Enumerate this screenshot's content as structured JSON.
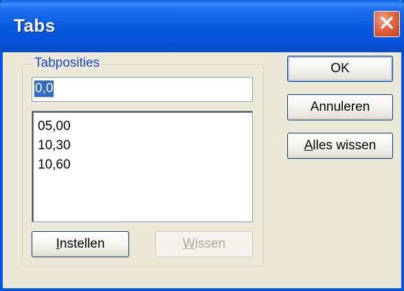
{
  "window": {
    "title": "Tabs"
  },
  "group": {
    "label": "Tabposities"
  },
  "input": {
    "value": "0,0"
  },
  "list": {
    "items": [
      "05,00",
      "10,30",
      "10,60"
    ]
  },
  "buttons": {
    "ok": "OK",
    "cancel": "Annuleren",
    "clear_all_first": "A",
    "clear_all_rest": "lles wissen",
    "set_first": "I",
    "set_rest": "nstellen",
    "clear_first": "W",
    "clear_rest": "issen"
  },
  "icons": {
    "close": "close-icon"
  },
  "colors": {
    "titlebar": "#0a5be0",
    "face": "#ece9d8",
    "selection": "#316ac5",
    "close": "#d9542c"
  }
}
